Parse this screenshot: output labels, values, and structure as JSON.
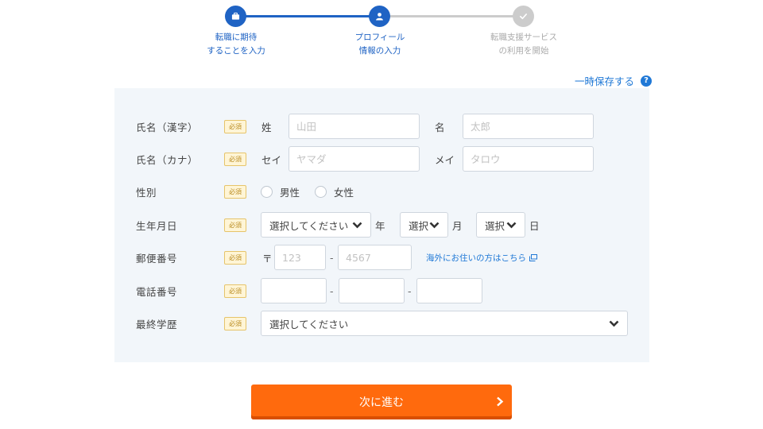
{
  "stepper": {
    "steps": [
      {
        "label": "転職に期待\nすることを入力",
        "icon": "briefcase-icon",
        "state": "done"
      },
      {
        "label": "プロフィール\n情報の入力",
        "icon": "user-icon",
        "state": "current"
      },
      {
        "label": "転職支援サービス\nの利用を開始",
        "icon": "check-icon",
        "state": "todo"
      }
    ]
  },
  "temp_save": {
    "label": "一時保存する",
    "help_icon": "?"
  },
  "form": {
    "required_badge": "必須",
    "name_kanji": {
      "label": "氏名（漢字）",
      "last_label": "姓",
      "last_placeholder": "山田",
      "first_label": "名",
      "first_placeholder": "太郎"
    },
    "name_kana": {
      "label": "氏名（カナ）",
      "last_label": "セイ",
      "last_placeholder": "ヤマダ",
      "first_label": "メイ",
      "first_placeholder": "タロウ"
    },
    "gender": {
      "label": "性別",
      "options": [
        "男性",
        "女性"
      ]
    },
    "birthdate": {
      "label": "生年月日",
      "year_select": "選択してください",
      "year_unit": "年",
      "month_select": "選択",
      "month_unit": "月",
      "day_select": "選択",
      "day_unit": "日"
    },
    "postal": {
      "label": "郵便番号",
      "symbol": "〒",
      "part1_placeholder": "123",
      "part2_placeholder": "4567",
      "separator": "-",
      "overseas_link": "海外にお住いの方はこちら"
    },
    "phone": {
      "label": "電話番号",
      "separator": "-"
    },
    "education": {
      "label": "最終学歴",
      "select": "選択してください"
    }
  },
  "next_button": {
    "label": "次に進む"
  },
  "colors": {
    "primary": "#1f63c4",
    "link": "#1f78d6",
    "cta": "#ff6a0d",
    "panel": "#f2f6fa",
    "inactive": "#cccccc"
  }
}
